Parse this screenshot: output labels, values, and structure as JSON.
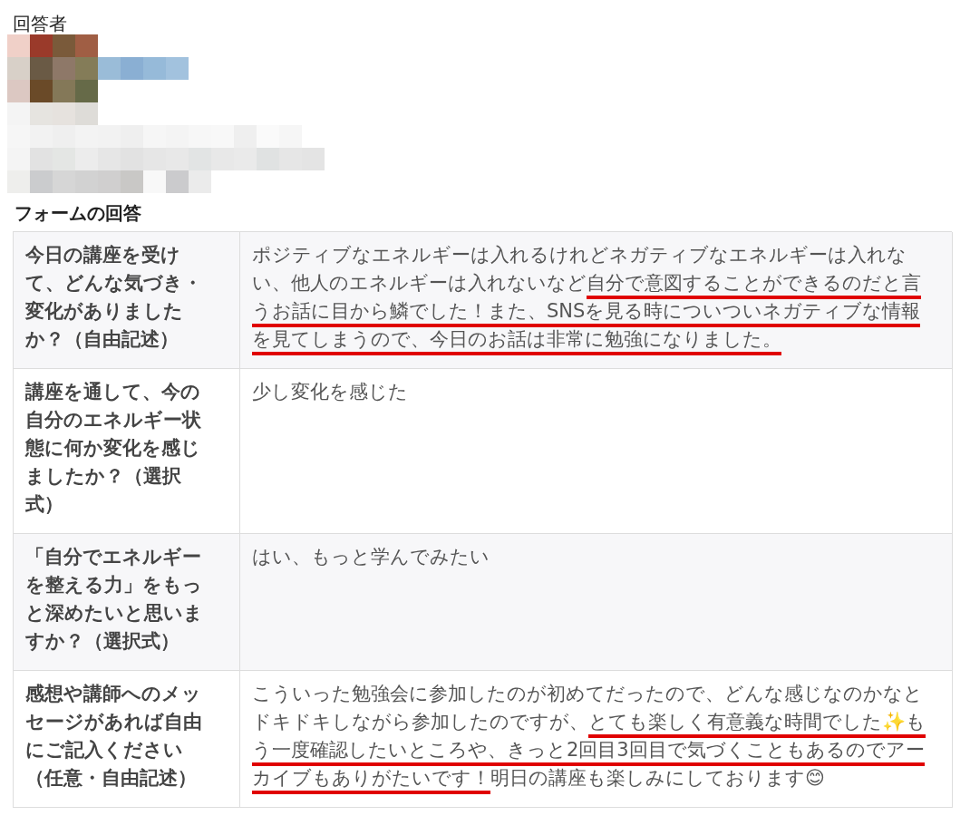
{
  "respondent": {
    "label": "回答者"
  },
  "form": {
    "title": "フォームの回答",
    "rows": [
      {
        "question": "今日の講座を受けて、どんな気づき・変化がありましたか？（自由記述）",
        "answer": [
          {
            "text": "ポジティブなエネルギーは入れるけれどネガティブなエネルギーは入れない、他人のエネルギーは入れないなど",
            "underlined": false
          },
          {
            "text": "自分で意図することができるのだと言うお話に目から鱗でした！また、SNSを見る時についついネガティブな情報を見てしまうので、今日のお話は非常に勉強になりました。",
            "underlined": true
          }
        ]
      },
      {
        "question": "講座を通して、今の自分のエネルギー状態に何か変化を感じましたか？（選択式）",
        "answer": [
          {
            "text": "少し変化を感じた",
            "underlined": false
          }
        ]
      },
      {
        "question": "「自分でエネルギーを整える力」をもっと深めたいと思いますか？（選択式）",
        "answer": [
          {
            "text": "はい、もっと学んでみたい",
            "underlined": false
          }
        ]
      },
      {
        "question": "感想や講師へのメッセージがあれば自由にご記入ください（任意・自由記述）",
        "answer": [
          {
            "text": "こういった勉強会に参加したのが初めてだったので、どんな感じなのかなとドキドキしながら参加したのですが、",
            "underlined": false
          },
          {
            "text": "とても楽しく有意義な時間でした✨もう一度確認したいところや、きっと2回目3回目で気づくこともあるのでアーカイブもありがたいです！",
            "underlined": true
          },
          {
            "text": "明日の講座も楽しみにしております😊",
            "underlined": false
          }
        ]
      }
    ]
  }
}
